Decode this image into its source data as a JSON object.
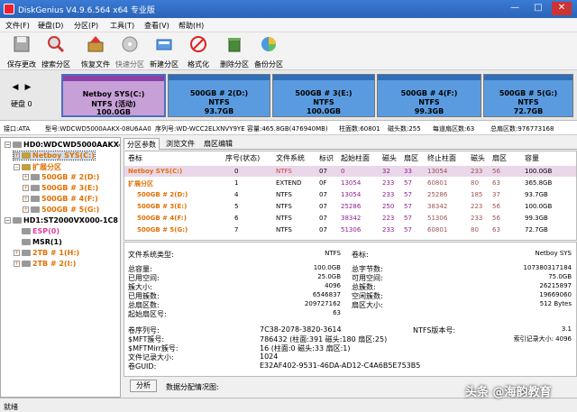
{
  "window": {
    "title": "DiskGenius V4.9.6.564 x64 专业版"
  },
  "menu": [
    "文件(F)",
    "硬盘(D)",
    "分区(P)",
    "工具(T)",
    "查看(V)",
    "帮助(H)"
  ],
  "toolbar": [
    {
      "label": "保存更改",
      "icon": "save-icon"
    },
    {
      "label": "搜索分区",
      "icon": "magnifier-icon"
    },
    {
      "label": "恢复文件",
      "icon": "recover-box-icon"
    },
    {
      "label": "快速分区",
      "icon": "disc-icon"
    },
    {
      "label": "新建分区",
      "icon": "new-partition-icon"
    },
    {
      "label": "格式化",
      "icon": "format-icon"
    },
    {
      "label": "删除分区",
      "icon": "trash-icon"
    },
    {
      "label": "备份分区",
      "icon": "backup-pie-icon"
    }
  ],
  "diskmap": {
    "disk_label": "硬盘 0",
    "partitions": [
      {
        "name": "Netboy SYS(C:)",
        "fs": "NTFS (活动)",
        "size": "100.0GB"
      },
      {
        "name": "500GB # 2(D:)",
        "fs": "NTFS",
        "size": "93.7GB"
      },
      {
        "name": "500GB # 3(E:)",
        "fs": "NTFS",
        "size": "100.0GB"
      },
      {
        "name": "500GB # 4(F:)",
        "fs": "NTFS",
        "size": "99.3GB"
      },
      {
        "name": "500GB # 5(G:)",
        "fs": "NTFS",
        "size": "72.7GB"
      }
    ]
  },
  "infobar": {
    "iface": "接口:ATA",
    "model": "型号:WDCWD5000AAKX-08U6AA0",
    "serial": "序列号:WD-WCC2ELXNVY9YE",
    "capacity": "容量:465.8GB(476940MB)",
    "cyl": "柱面数:60801",
    "heads": "磁头数:255",
    "spt": "每道扇区数:63",
    "sectors": "总扇区数:976773168"
  },
  "tree": [
    {
      "text": "HD0:WDCWD5000AAKX-0",
      "exp": "−",
      "cls": ""
    },
    {
      "text": "Netboy SYS(C:)",
      "exp": "+",
      "cls": "orange sel"
    },
    {
      "text": "扩展分区",
      "exp": "−",
      "cls": "orange"
    },
    {
      "text": "500GB # 2(D:)",
      "exp": "+",
      "cls": "orange"
    },
    {
      "text": "500GB # 3(E:)",
      "exp": "+",
      "cls": "orange"
    },
    {
      "text": "500GB # 4(F:)",
      "exp": "+",
      "cls": "orange"
    },
    {
      "text": "500GB # 5(G:)",
      "exp": "+",
      "cls": "orange"
    },
    {
      "text": "HD1:ST2000VX000-1C8",
      "exp": "−",
      "cls": ""
    },
    {
      "text": "ESP(0)",
      "exp": "",
      "cls": "pinkc"
    },
    {
      "text": "MSR(1)",
      "exp": "",
      "cls": ""
    },
    {
      "text": "2TB # 1(H:)",
      "exp": "+",
      "cls": "orange"
    },
    {
      "text": "2TB # 2(I:)",
      "exp": "+",
      "cls": "orange"
    }
  ],
  "tabs": [
    "分区参数",
    "浏览文件",
    "扇区编辑"
  ],
  "table": {
    "headers": [
      "卷标",
      "序号(状态)",
      "文件系统",
      "标识",
      "起始柱面",
      "磁头",
      "扇区",
      "终止柱面",
      "磁头",
      "扇区",
      "容量"
    ],
    "rows": [
      {
        "label": "Netboy SYS(C:)",
        "cells": [
          "0",
          "NTFS",
          "07",
          "0",
          "32",
          "33",
          "13054",
          "233",
          "56",
          "100.0GB"
        ]
      },
      {
        "label": "扩展分区",
        "cells": [
          "1",
          "EXTEND",
          "0F",
          "13054",
          "233",
          "57",
          "60801",
          "80",
          "63",
          "365.8GB"
        ]
      },
      {
        "label": "500GB # 2(D:)",
        "cells": [
          "4",
          "NTFS",
          "07",
          "13054",
          "233",
          "57",
          "25286",
          "185",
          "37",
          "93.7GB"
        ]
      },
      {
        "label": "500GB # 3(E:)",
        "cells": [
          "5",
          "NTFS",
          "07",
          "25286",
          "250",
          "57",
          "38342",
          "223",
          "56",
          "100.0GB"
        ]
      },
      {
        "label": "500GB # 4(F:)",
        "cells": [
          "6",
          "NTFS",
          "07",
          "38342",
          "223",
          "57",
          "51306",
          "233",
          "56",
          "99.3GB"
        ]
      },
      {
        "label": "500GB # 5(G:)",
        "cells": [
          "7",
          "NTFS",
          "07",
          "51306",
          "233",
          "57",
          "60801",
          "80",
          "63",
          "72.7GB"
        ]
      }
    ]
  },
  "details": {
    "fs_type_label": "文件系统类型:",
    "fs_type": "NTFS",
    "volume_label": "卷标:",
    "volume": "Netboy SYS",
    "left": [
      [
        "总容量:",
        "100.0GB"
      ],
      [
        "已用空间:",
        "25.0GB"
      ],
      [
        "簇大小:",
        "4096"
      ],
      [
        "已用簇数:",
        "6546837"
      ],
      [
        "总扇区数:",
        "209727162"
      ],
      [
        "起始扇区号:",
        "63"
      ]
    ],
    "right": [
      [
        "总字节数:",
        "107380317184"
      ],
      [
        "可用空间:",
        "75.0GB"
      ],
      [
        "总簇数:",
        "26215897"
      ],
      [
        "空闲簇数:",
        "19669060"
      ],
      [
        "扇区大小:",
        "512 Bytes"
      ],
      [
        "",
        ""
      ]
    ],
    "bottom_left": [
      [
        "卷序列号:",
        "7C38-2078-3820-3614"
      ],
      [
        "$MFT簇号:",
        "786432 (柱面:391 磁头:180 扇区:25)"
      ],
      [
        "$MFTMirr簇号:",
        "16 (柱面:0 磁头:33 扇区:1)"
      ],
      [
        "文件记录大小:",
        "1024"
      ],
      [
        "卷GUID:",
        "E32AF402-9531-46DA-AD12-C4A6B5E753B5"
      ]
    ],
    "bottom_right": [
      [
        "NTFS版本号:",
        "3.1"
      ],
      [
        "",
        "索引记录大小:  4096"
      ]
    ]
  },
  "analyze_label": "分析",
  "distribution_label": "数据分配情况图:",
  "status": "就绪",
  "watermark": "头条 @海韵教育"
}
